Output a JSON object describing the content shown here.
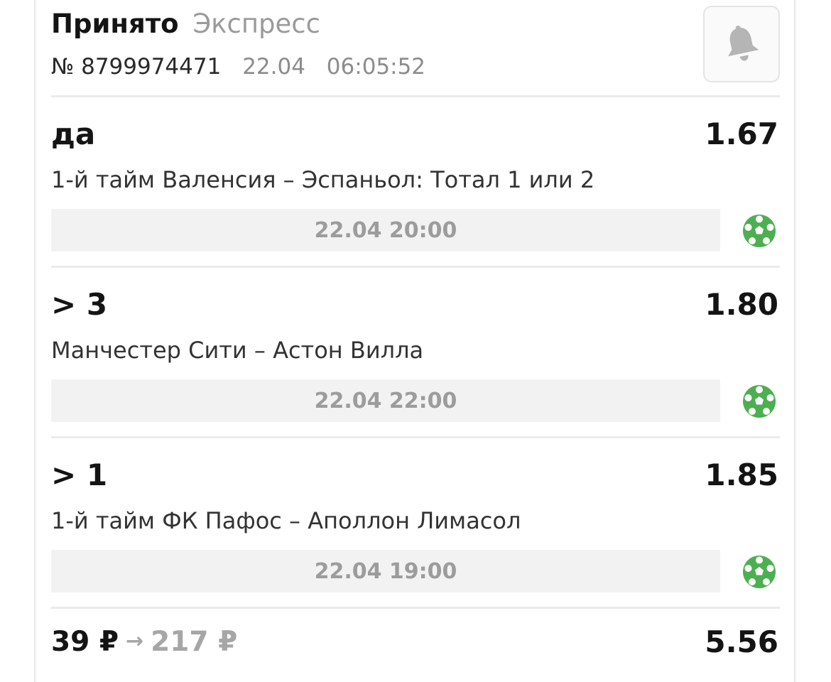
{
  "header": {
    "status": "Принято",
    "bet_type": "Экспресс",
    "bet_number": "№ 8799974471",
    "date": "22.04",
    "time": "06:05:52",
    "bell_icon": "bell-icon"
  },
  "events": [
    {
      "outcome": "да",
      "odds": "1.67",
      "description": "1-й тайм Валенсия – Эспаньол: Тотал 1 или 2",
      "start": "22.04 20:00",
      "sport_icon": "soccer-ball-icon"
    },
    {
      "outcome": "> 3",
      "odds": "1.80",
      "description": "Манчестер Сити – Астон Вилла",
      "start": "22.04 22:00",
      "sport_icon": "soccer-ball-icon"
    },
    {
      "outcome": "> 1",
      "odds": "1.85",
      "description": "1-й тайм ФК Пафос – Аполлон Лимасол",
      "start": "22.04 19:00",
      "sport_icon": "soccer-ball-icon"
    }
  ],
  "summary": {
    "stake": "39 ₽",
    "arrow": "→",
    "payout": "217 ₽",
    "total_odds": "5.56"
  },
  "colors": {
    "sport_icon": "#4caf50",
    "muted_text": "#9a9a9a",
    "divider": "#ebebeb",
    "start_bar": "#f2f2f2"
  }
}
